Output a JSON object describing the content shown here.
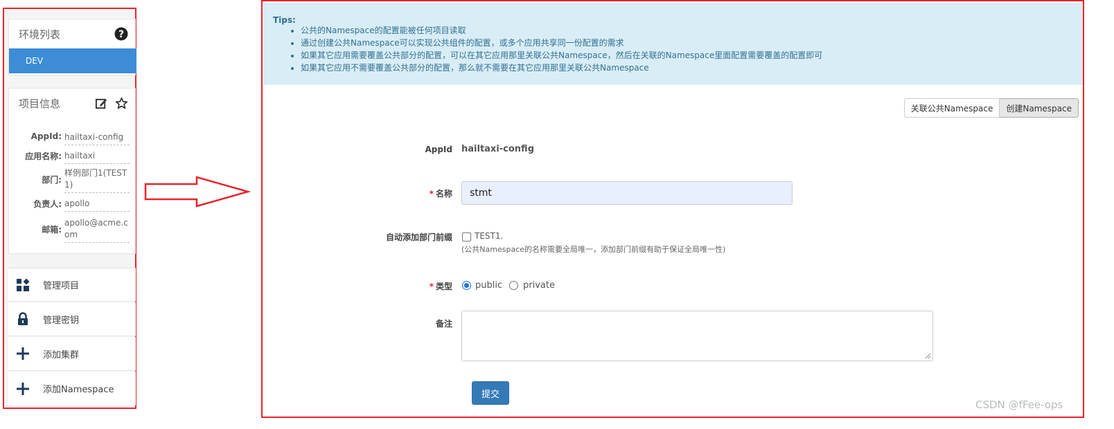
{
  "sidebar": {
    "env_panel": {
      "title": "环境列表",
      "items": [
        "DEV"
      ]
    },
    "project_panel": {
      "title": "项目信息",
      "fields": [
        {
          "label": "AppId:",
          "value": "hailtaxi-config"
        },
        {
          "label": "应用名称:",
          "value": "hailtaxi"
        },
        {
          "label": "部门:",
          "value": "样例部门1(TEST1)"
        },
        {
          "label": "负责人:",
          "value": "apollo"
        },
        {
          "label": "邮箱:",
          "value": "apollo@acme.com"
        }
      ]
    },
    "nav": [
      {
        "label": "管理项目",
        "icon": "grid-icon"
      },
      {
        "label": "管理密钥",
        "icon": "lock-icon"
      },
      {
        "label": "添加集群",
        "icon": "plus-icon"
      },
      {
        "label": "添加Namespace",
        "icon": "plus-icon"
      }
    ]
  },
  "tips": {
    "title": "Tips:",
    "items": [
      "公共的Namespace的配置能被任何项目读取",
      "通过创建公共Namespace可以实现公共组件的配置，或多个应用共享同一份配置的需求",
      "如果其它应用需要覆盖公共部分的配置，可以在其它应用那里关联公共Namespace，然后在关联的Namespace里面配置需要覆盖的配置即可",
      "如果其它应用不需要覆盖公共部分的配置，那么就不需要在其它应用那里关联公共Namespace"
    ]
  },
  "toolbar": {
    "link_label": "关联公共Namespace",
    "create_label": "创建Namespace"
  },
  "form": {
    "appid_label": "AppId",
    "appid_value": "hailtaxi-config",
    "name_label": "名称",
    "name_value": "stmt",
    "prefix_label": "自动添加部门前缀",
    "prefix_option": "TEST1.",
    "prefix_hint": "(公共Namespace的名称需要全局唯一，添加部门前缀有助于保证全局唯一性)",
    "type_label": "类型",
    "type_options": [
      "public",
      "private"
    ],
    "type_selected": "public",
    "comment_label": "备注",
    "required_mark": "*",
    "submit_label": "提交"
  },
  "watermark": "CSDN @fFee-ops",
  "colors": {
    "highlight_border": "#e8242c",
    "primary": "#3c8dd5",
    "tips_bg": "#d9edf7"
  }
}
